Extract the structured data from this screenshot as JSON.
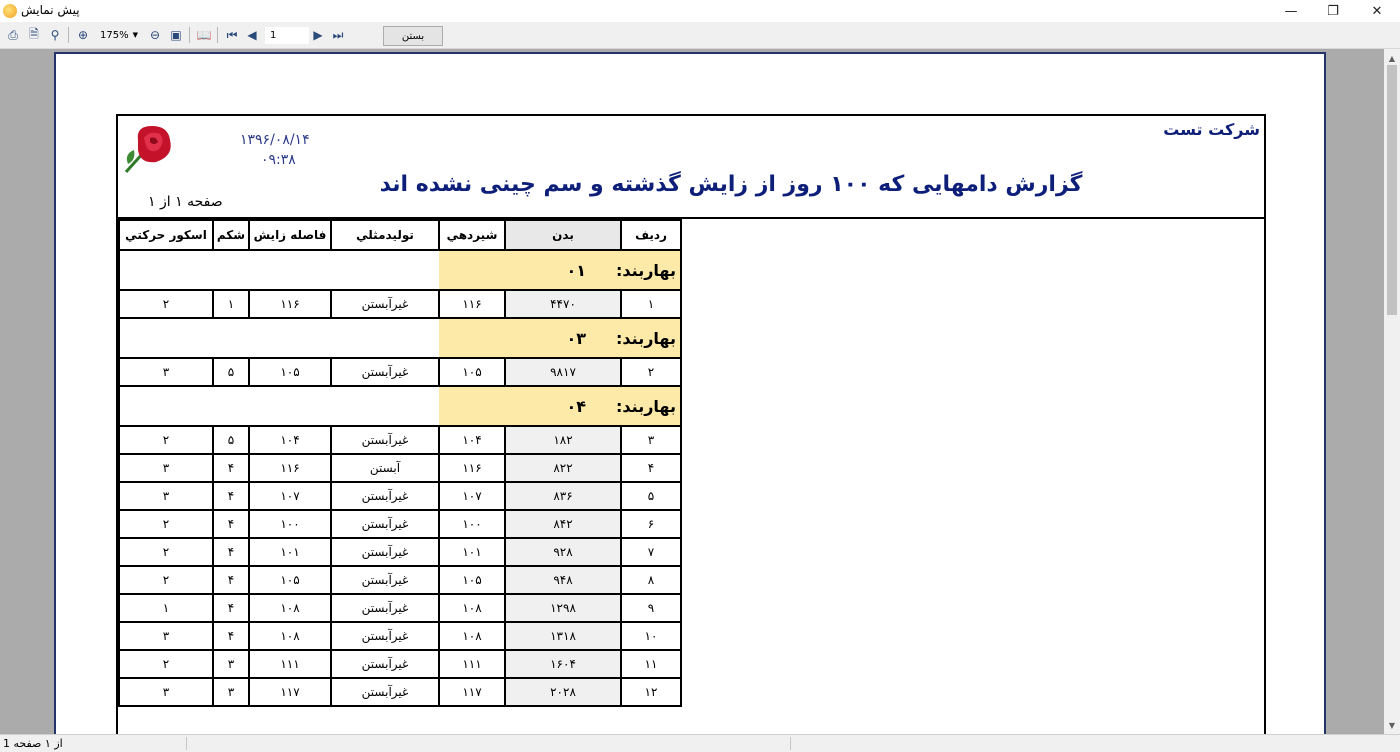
{
  "window": {
    "title": "پیش نمایش"
  },
  "toolbar": {
    "zoom": "175%",
    "page": "1",
    "close_label": "بستن"
  },
  "status": {
    "page_info": "از ۱ صفحه 1"
  },
  "report": {
    "company": "شرکت تست",
    "title": "گزارش دامهایی که ۱۰۰ روز از زایش گذشته و سم چینی نشده اند",
    "date": "۱۳۹۶/۰۸/۱۴",
    "time": "۰۹:۳۸",
    "page_count": "صفحه ۱ از ۱",
    "columns": [
      "رديف",
      "بدن",
      "شيردهي",
      "توليدمثلي",
      "فاصله زايش",
      "شکم",
      "اسکور حرکتي"
    ],
    "groups": [
      {
        "label": "بهاربند:",
        "value": "۰۱",
        "rows": [
          [
            "۱",
            "۴۴۷۰",
            "۱۱۶",
            "غیرآبستن",
            "۱۱۶",
            "۱",
            "۲"
          ]
        ]
      },
      {
        "label": "بهاربند:",
        "value": "۰۳",
        "rows": [
          [
            "۲",
            "۹۸۱۷",
            "۱۰۵",
            "غیرآبستن",
            "۱۰۵",
            "۵",
            "۳"
          ]
        ]
      },
      {
        "label": "بهاربند:",
        "value": "۰۴",
        "rows": [
          [
            "۳",
            "۱۸۲",
            "۱۰۴",
            "غیرآبستن",
            "۱۰۴",
            "۵",
            "۲"
          ],
          [
            "۴",
            "۸۲۲",
            "۱۱۶",
            "آبستن",
            "۱۱۶",
            "۴",
            "۳"
          ],
          [
            "۵",
            "۸۳۶",
            "۱۰۷",
            "غیرآبستن",
            "۱۰۷",
            "۴",
            "۳"
          ],
          [
            "۶",
            "۸۴۲",
            "۱۰۰",
            "غیرآبستن",
            "۱۰۰",
            "۴",
            "۲"
          ],
          [
            "۷",
            "۹۲۸",
            "۱۰۱",
            "غیرآبستن",
            "۱۰۱",
            "۴",
            "۲"
          ],
          [
            "۸",
            "۹۴۸",
            "۱۰۵",
            "غیرآبستن",
            "۱۰۵",
            "۴",
            "۲"
          ],
          [
            "۹",
            "۱۲۹۸",
            "۱۰۸",
            "غیرآبستن",
            "۱۰۸",
            "۴",
            "۱"
          ],
          [
            "۱۰",
            "۱۳۱۸",
            "۱۰۸",
            "غیرآبستن",
            "۱۰۸",
            "۴",
            "۳"
          ],
          [
            "۱۱",
            "۱۶۰۴",
            "۱۱۱",
            "غیرآبستن",
            "۱۱۱",
            "۳",
            "۲"
          ],
          [
            "۱۲",
            "۲۰۲۸",
            "۱۱۷",
            "غیرآبستن",
            "۱۱۷",
            "۳",
            "۳"
          ]
        ]
      }
    ]
  },
  "colors": {
    "title_blue": "#0e1f7a",
    "group_fill": "#fde9a8",
    "body_shade": "#f0f0f0",
    "viewport_gray": "#ababab"
  }
}
